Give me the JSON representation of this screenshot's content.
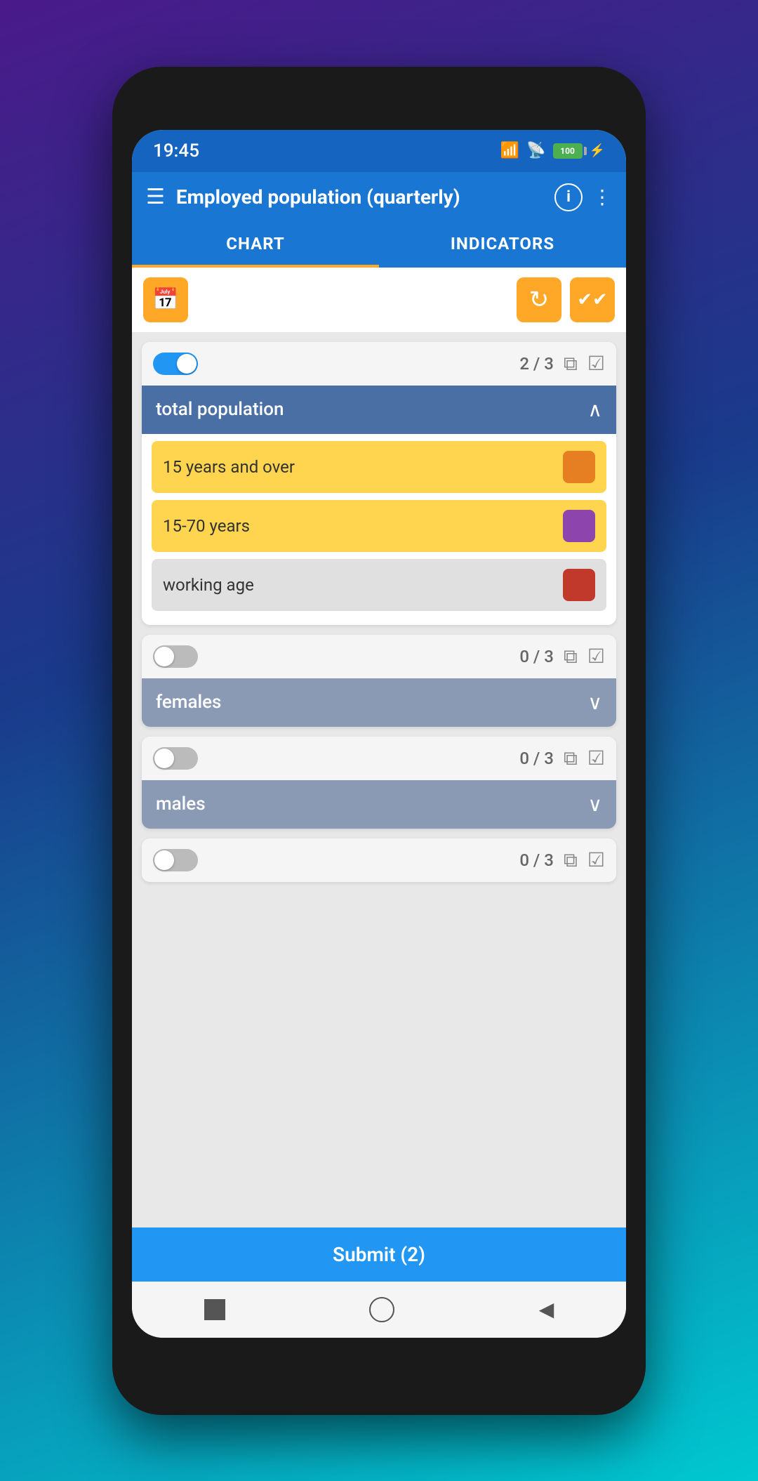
{
  "status_bar": {
    "time": "19:45",
    "battery": "100"
  },
  "header": {
    "title": "Employed population (quarterly)",
    "info_label": "i",
    "more_label": "⋮"
  },
  "tabs": [
    {
      "id": "chart",
      "label": "CHART",
      "active": true
    },
    {
      "id": "indicators",
      "label": "INDICATORS",
      "active": false
    }
  ],
  "toolbar": {
    "calendar_icon": "▦",
    "refresh_icon": "↻",
    "check_icon": "✔✔"
  },
  "sections": [
    {
      "id": "total-population",
      "name": "total population",
      "toggle_on": true,
      "count": "2 / 3",
      "expanded": true,
      "items": [
        {
          "id": "15-years-and-over",
          "label": "15 years and over",
          "selected": true,
          "color": "#e67e22"
        },
        {
          "id": "15-70-years",
          "label": "15-70 years",
          "selected": true,
          "color": "#8e44ad"
        },
        {
          "id": "working-age",
          "label": "working age",
          "selected": false,
          "color": "#c0392b"
        }
      ]
    },
    {
      "id": "females",
      "name": "females",
      "toggle_on": false,
      "count": "0 / 3",
      "expanded": false,
      "items": []
    },
    {
      "id": "males",
      "name": "males",
      "toggle_on": false,
      "count": "0 / 3",
      "expanded": false,
      "items": []
    },
    {
      "id": "extra",
      "name": "",
      "toggle_on": false,
      "count": "0 / 3",
      "expanded": false,
      "items": []
    }
  ],
  "submit_button": {
    "label": "Submit (2)"
  }
}
